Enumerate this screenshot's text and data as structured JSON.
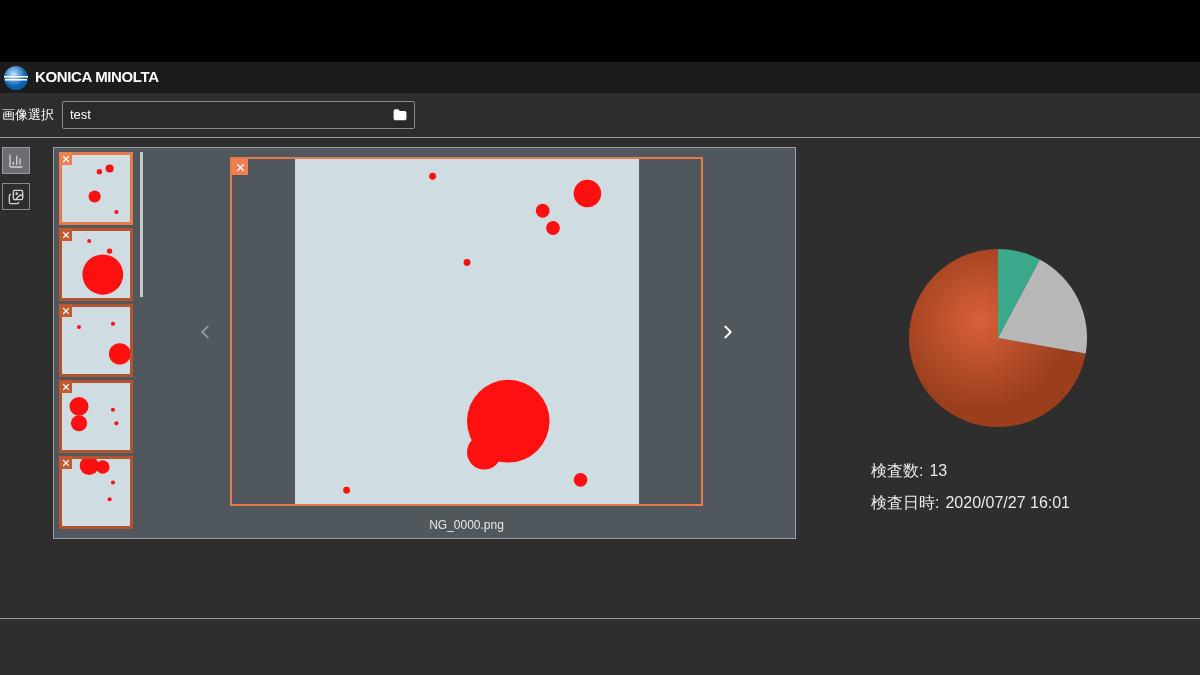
{
  "header": {
    "logo_text": "KONICA MINOLTA"
  },
  "image_select": {
    "label": "画像選択",
    "value": "test"
  },
  "tools": [
    {
      "kind": "chart",
      "selected": true
    },
    {
      "kind": "gallery",
      "selected": false
    }
  ],
  "thumbnails": [
    {
      "selected": true
    },
    {
      "selected": false
    },
    {
      "selected": false
    },
    {
      "selected": false
    },
    {
      "selected": false
    }
  ],
  "viewer": {
    "filename": "NG_0000.png",
    "prev_disabled": true,
    "next_disabled": false
  },
  "stats": [
    {
      "label": "検査数:",
      "value": "13"
    },
    {
      "label": "検査日時:",
      "value": "2020/07/27 16:01"
    }
  ]
}
